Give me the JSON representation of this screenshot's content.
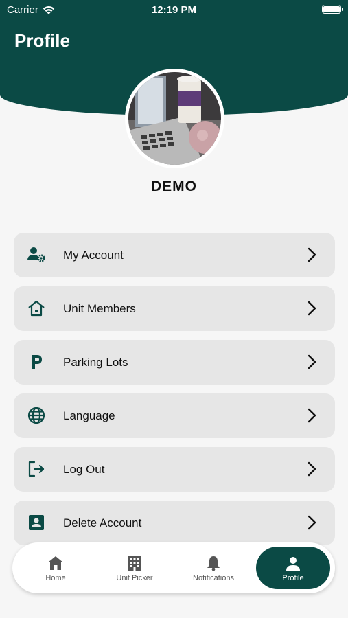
{
  "status_bar": {
    "carrier": "Carrier",
    "time": "12:19 PM"
  },
  "header": {
    "title": "Profile"
  },
  "profile": {
    "name": "DEMO"
  },
  "menu": [
    {
      "label": "My Account",
      "icon": "user-gear-icon"
    },
    {
      "label": "Unit Members",
      "icon": "home-icon"
    },
    {
      "label": "Parking Lots",
      "icon": "parking-icon"
    },
    {
      "label": "Language",
      "icon": "globe-icon"
    },
    {
      "label": "Log Out",
      "icon": "logout-icon"
    },
    {
      "label": "Delete Account",
      "icon": "account-box-icon"
    }
  ],
  "bottom_nav": [
    {
      "label": "Home",
      "icon": "home-icon",
      "active": false
    },
    {
      "label": "Unit Picker",
      "icon": "building-icon",
      "active": false
    },
    {
      "label": "Notifications",
      "icon": "bell-icon",
      "active": false
    },
    {
      "label": "Profile",
      "icon": "person-icon",
      "active": true
    }
  ],
  "colors": {
    "brand": "#0b4a45",
    "menu_bg": "#e6e6e6",
    "page_bg": "#f6f6f6"
  }
}
